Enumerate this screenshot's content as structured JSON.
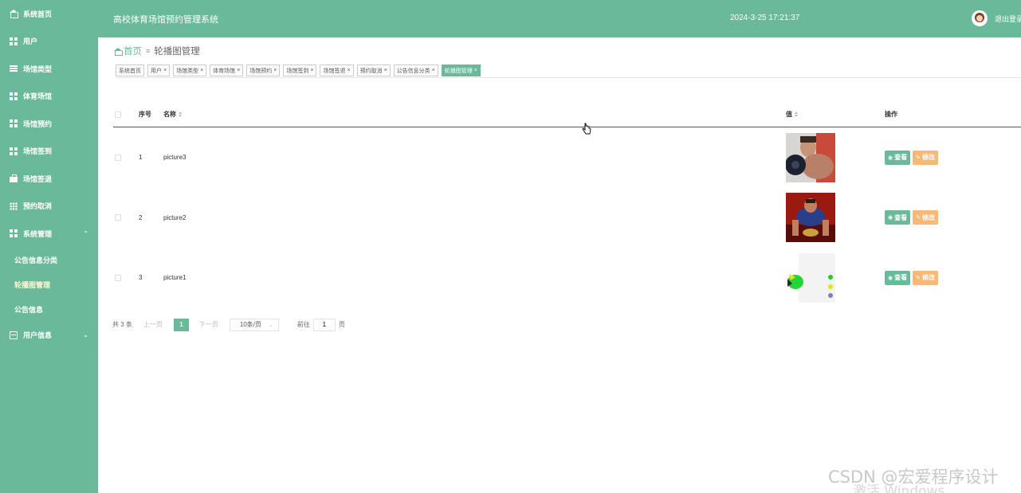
{
  "sidebar": {
    "items": [
      {
        "label": "系统首页",
        "icon": "home-icon"
      },
      {
        "label": "用户",
        "icon": "grid-icon"
      },
      {
        "label": "场馆类型",
        "icon": "list-icon"
      },
      {
        "label": "体育场馆",
        "icon": "grid-icon"
      },
      {
        "label": "场馆预约",
        "icon": "grid-icon"
      },
      {
        "label": "场馆签到",
        "icon": "grid-icon"
      },
      {
        "label": "场馆签退",
        "icon": "bag-icon"
      },
      {
        "label": "预约取消",
        "icon": "dots-icon"
      },
      {
        "label": "系统管理",
        "icon": "grid-icon",
        "expanded": true
      },
      {
        "label": "用户信息",
        "icon": "card-icon"
      }
    ],
    "sub_items": [
      {
        "label": "公告信息分类"
      },
      {
        "label": "轮播图管理",
        "active": true
      },
      {
        "label": "公告信息"
      }
    ]
  },
  "header": {
    "title": "高校体育场馆预约管理系统",
    "datetime": "2024-3-25 17:21:37",
    "logout": "退出登录"
  },
  "breadcrumb": {
    "home": "首页",
    "current": "轮播图管理"
  },
  "tags": [
    {
      "label": "系统首页",
      "closable": false
    },
    {
      "label": "用户",
      "closable": true
    },
    {
      "label": "场馆类型",
      "closable": true
    },
    {
      "label": "体育场馆",
      "closable": true
    },
    {
      "label": "场馆预约",
      "closable": true
    },
    {
      "label": "场馆签到",
      "closable": true
    },
    {
      "label": "场馆签退",
      "closable": true
    },
    {
      "label": "预约取消",
      "closable": true
    },
    {
      "label": "公告信息分类",
      "closable": true
    },
    {
      "label": "轮播图管理",
      "closable": true,
      "active": true
    }
  ],
  "table": {
    "headers": {
      "index": "序号",
      "name": "名称",
      "value": "值",
      "action": "操作"
    },
    "rows": [
      {
        "index": "1",
        "name": "picture3"
      },
      {
        "index": "2",
        "name": "picture2"
      },
      {
        "index": "3",
        "name": "picture1"
      }
    ],
    "view_label": "查看",
    "edit_label": "修改"
  },
  "pagination": {
    "total": "共 3 条",
    "prev": "上一页",
    "page": "1",
    "next": "下一页",
    "page_size": "10条/页",
    "goto_prefix": "前往",
    "goto_value": "1",
    "goto_suffix": "页"
  },
  "watermark": {
    "csdn": "CSDN @宏爱程序设计",
    "windows": "激活 Windows"
  },
  "colors": {
    "primary": "#6ab99a",
    "edit": "#f8b976"
  }
}
